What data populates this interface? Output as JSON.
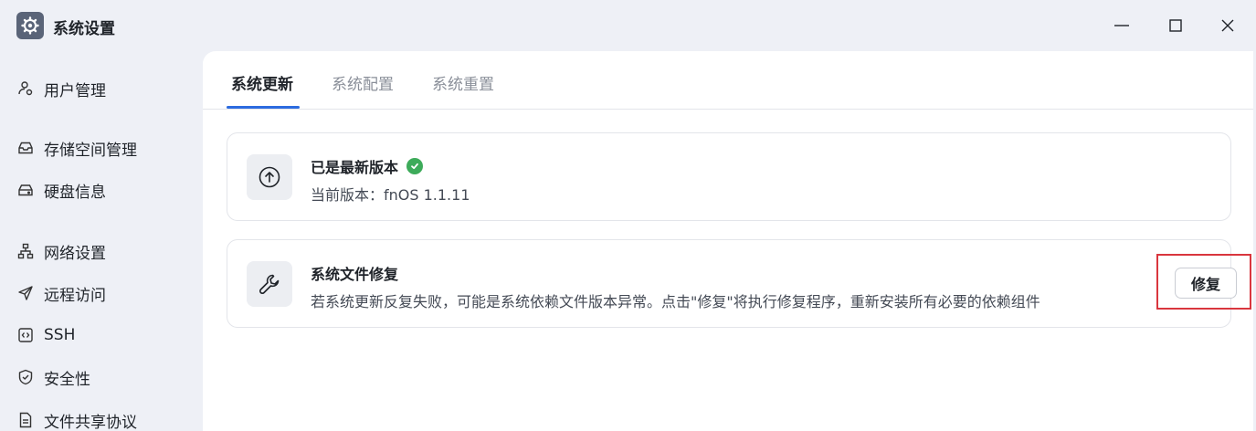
{
  "window": {
    "title": "系统设置",
    "icons": {
      "app": "gear-icon",
      "minimize": "minimize-icon",
      "maximize": "maximize-icon",
      "close": "close-icon"
    }
  },
  "sidebar": {
    "items": [
      {
        "label": "用户管理",
        "icon": "user-group-icon"
      },
      {
        "label": "存储空间管理",
        "icon": "storage-icon"
      },
      {
        "label": "硬盘信息",
        "icon": "disk-icon"
      },
      {
        "label": "网络设置",
        "icon": "network-icon"
      },
      {
        "label": "远程访问",
        "icon": "send-icon"
      },
      {
        "label": "SSH",
        "icon": "code-icon"
      },
      {
        "label": "安全性",
        "icon": "shield-icon"
      },
      {
        "label": "文件共享协议",
        "icon": "document-icon"
      }
    ]
  },
  "main": {
    "tabs": [
      {
        "label": "系统更新",
        "active": true
      },
      {
        "label": "系统配置",
        "active": false
      },
      {
        "label": "系统重置",
        "active": false
      }
    ],
    "update_card": {
      "title": "已是最新版本",
      "status_icon": "check-circle-icon",
      "icon": "arrow-up-circle-icon",
      "desc": "当前版本：fnOS 1.1.11"
    },
    "repair_card": {
      "title": "系统文件修复",
      "icon": "wrench-icon",
      "desc": "若系统更新反复失败，可能是系统依赖文件版本异常。点击\"修复\"将执行修复程序，重新安装所有必要的依赖组件",
      "button_label": "修复"
    }
  },
  "colors": {
    "accent": "#2c6be0",
    "success": "#3dab5a",
    "highlight_border": "#d9363e",
    "background": "#eef0f6"
  }
}
